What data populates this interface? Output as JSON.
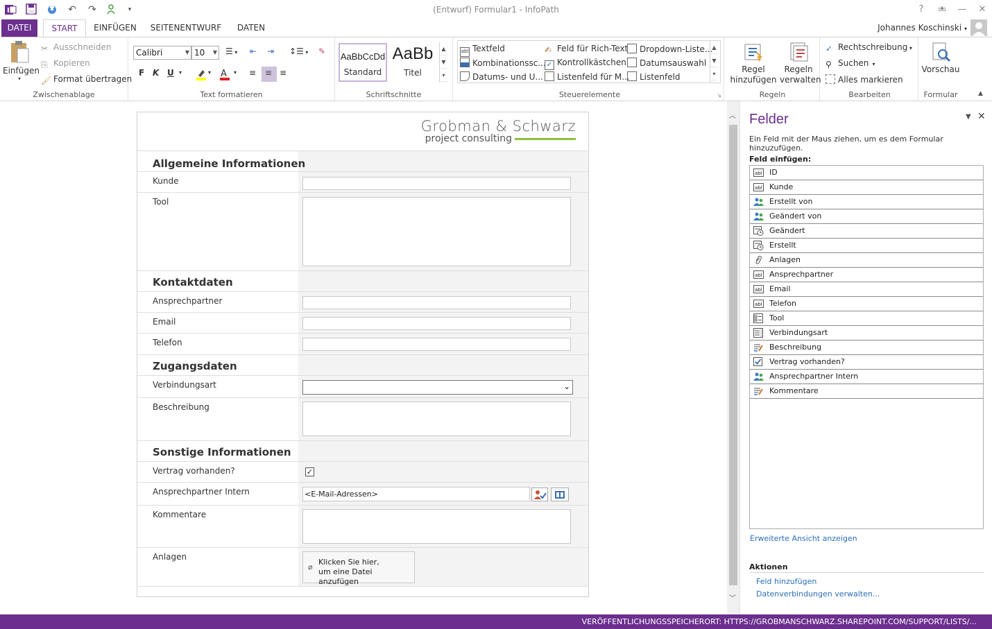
{
  "window": {
    "title": "(Entwurf) Formular1 - InfoPath",
    "user": "Johannes Koschinski",
    "help": "?"
  },
  "tabs": [
    "DATEI",
    "START",
    "EINFÜGEN",
    "SEITENENTWURF",
    "DATEN"
  ],
  "ribbon": {
    "clipboard": {
      "paste": "Einfügen",
      "cut": "Ausschneiden",
      "copy": "Kopieren",
      "format_painter": "Format übertragen",
      "label": "Zwischenablage"
    },
    "text_format": {
      "font": "Calibri",
      "size": "10",
      "bold": "F",
      "italic": "K",
      "underline": "U",
      "label": "Text formatieren"
    },
    "styles": {
      "standard_sample": "AaBbCcDd",
      "standard": "Standard",
      "title_sample": "AaBb",
      "title": "Titel",
      "label": "Schriftschnitte"
    },
    "controls": {
      "items": [
        "Textfeld",
        "Feld für Rich-Text",
        "Dropdown-Liste...",
        "Kombinationssc...",
        "Kontrollkästchen",
        "Datumsauswahl",
        "Datums- und U...",
        "Listenfeld für M...",
        "Listenfeld"
      ],
      "label": "Steuerelemente"
    },
    "rules": {
      "add_rule": "Regel hinzufügen",
      "manage_rules": "Regeln verwalten",
      "label": "Regeln"
    },
    "editing": {
      "spelling": "Rechtschreibung",
      "find": "Suchen",
      "select_all": "Alles markieren",
      "label": "Bearbeiten"
    },
    "form": {
      "preview": "Vorschau",
      "label": "Formular"
    }
  },
  "form": {
    "logo_line1": "Grobman & Schwarz",
    "logo_line2": "project consulting",
    "sections": {
      "general": "Allgemeine Informationen",
      "contact": "Kontaktdaten",
      "access": "Zugangsdaten",
      "other": "Sonstige Informationen"
    },
    "labels": {
      "kunde": "Kunde",
      "tool": "Tool",
      "ansprechpartner": "Ansprechpartner",
      "email": "Email",
      "telefon": "Telefon",
      "verbindungsart": "Verbindungsart",
      "beschreibung": "Beschreibung",
      "vertrag": "Vertrag vorhanden?",
      "ansprechpartner_intern": "Ansprechpartner Intern",
      "kommentare": "Kommentare",
      "anlagen": "Anlagen"
    },
    "people_picker_placeholder": "<E-Mail-Adressen>",
    "attach_line1": "Klicken Sie hier,",
    "attach_line2": "um eine Datei anzufügen"
  },
  "panel": {
    "title": "Felder",
    "hint": "Ein Feld mit der Maus ziehen, um es dem Formular hinzuzufügen.",
    "insert_label": "Feld einfügen:",
    "fields": [
      {
        "name": "ID",
        "icon": "text-field-icon"
      },
      {
        "name": "Kunde",
        "icon": "text-field-icon"
      },
      {
        "name": "Erstellt von",
        "icon": "person-icon"
      },
      {
        "name": "Geändert von",
        "icon": "person-icon"
      },
      {
        "name": "Geändert",
        "icon": "date-time-icon"
      },
      {
        "name": "Erstellt",
        "icon": "date-time-icon"
      },
      {
        "name": "Anlagen",
        "icon": "paperclip-icon"
      },
      {
        "name": "Ansprechpartner",
        "icon": "text-field-icon"
      },
      {
        "name": "Email",
        "icon": "text-field-icon"
      },
      {
        "name": "Telefon",
        "icon": "text-field-icon"
      },
      {
        "name": "Tool",
        "icon": "multi-select-icon"
      },
      {
        "name": "Verbindungsart",
        "icon": "dropdown-list-icon"
      },
      {
        "name": "Beschreibung",
        "icon": "rich-text-icon"
      },
      {
        "name": "Vertrag vorhanden?",
        "icon": "checkbox-icon"
      },
      {
        "name": "Ansprechpartner Intern",
        "icon": "person-icon"
      },
      {
        "name": "Kommentare",
        "icon": "rich-text-icon"
      }
    ],
    "advanced_view": "Erweiterte Ansicht anzeigen",
    "actions_label": "Aktionen",
    "add_field": "Feld hinzufügen",
    "manage_data": "Datenverbindungen verwalten..."
  },
  "status": {
    "publish_location": "VERÖFFENTLICHUNGSSPEICHERORT: HTTPS://GROBMANSCHWARZ.SHAREPOINT.COM/SUPPORT/LISTS/..."
  },
  "colors": {
    "accent": "#6b2f8e",
    "logo_green": "#8cbf3f",
    "link": "#2a6ebb"
  }
}
